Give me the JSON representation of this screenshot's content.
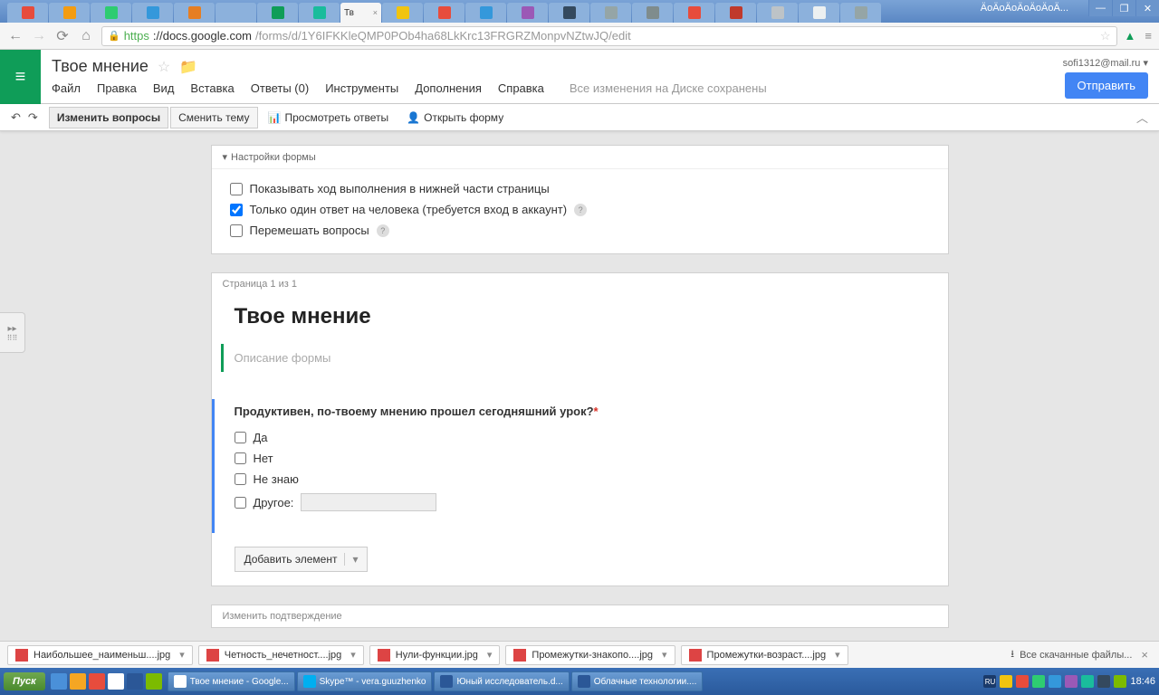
{
  "browser": {
    "window_title": "ÄoÄoÄoÄoÄoÄoÄ...",
    "active_tab": "Тв",
    "tabs_favicons": [
      "#e74c3c",
      "#f39c12",
      "#2ecc71",
      "#3498db",
      "#e67e22",
      "#8cb1dc",
      "#0f9d58",
      "#1abc9c",
      "#16a085",
      "#f1c40f",
      "#e74c3c",
      "#3498db",
      "#9b59b6",
      "#34495e",
      "#95a5a6",
      "#7f8c8d",
      "#e74c3c",
      "#c0392b",
      "#bdc3c7",
      "#ecf0f1",
      "#95a5a6"
    ],
    "url_proto": "https",
    "url_domain": "://docs.google.com",
    "url_path": "/forms/d/1Y6IFKKleQMP0POb4ha68LkKrc13FRGRZMonpvNZtwJQ/edit"
  },
  "docs": {
    "title": "Твое мнение",
    "menu": [
      "Файл",
      "Правка",
      "Вид",
      "Вставка",
      "Ответы (0)",
      "Инструменты",
      "Дополнения",
      "Справка"
    ],
    "saved_msg": "Все изменения на Диске сохранены",
    "user_email": "sofi1312@mail.ru ▾",
    "send_btn": "Отправить"
  },
  "toolbar": {
    "edit_questions": "Изменить вопросы",
    "change_theme": "Сменить тему",
    "view_responses": "Просмотреть ответы",
    "open_form": "Открыть форму"
  },
  "settings": {
    "header": "Настройки формы",
    "opt1": "Показывать ход выполнения в нижней части страницы",
    "opt2": "Только один ответ на человека (требуется вход в аккаунт)",
    "opt3": "Перемешать вопросы"
  },
  "form": {
    "page_badge": "Страница 1 из 1",
    "title": "Твое мнение",
    "desc_placeholder": "Описание формы",
    "question": "Продуктивен, по-твоему мнению прошел сегодняшний урок?",
    "options": [
      "Да",
      "Нет",
      "Не знаю"
    ],
    "other_label": "Другое:",
    "add_element": "Добавить элемент",
    "confirm_header": "Изменить подтверждение"
  },
  "downloads": {
    "items": [
      "Наибольшее_наименьш....jpg",
      "Четность_нечетност....jpg",
      "Нули-функции.jpg",
      "Промежутки-знакопо....jpg",
      "Промежутки-возраст....jpg"
    ],
    "show_all": "Все скачанные файлы...",
    "close": "×"
  },
  "taskbar": {
    "start": "Пуск",
    "items": [
      "Твое мнение - Google...",
      "Skype™ - vera.guuzhenko",
      "Юный исследователь.d...",
      "Облачные технологии...."
    ],
    "lang": "RU",
    "clock": "18:46"
  }
}
